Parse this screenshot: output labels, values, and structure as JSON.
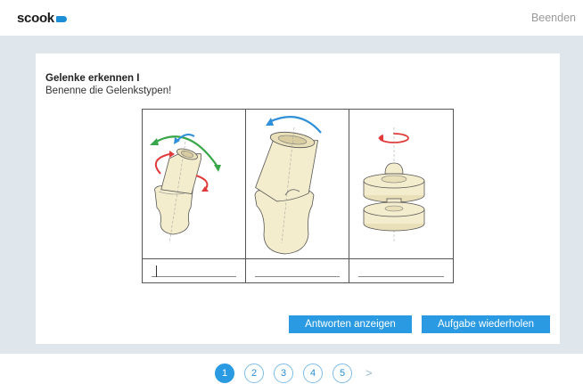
{
  "header": {
    "logo_text": "scook",
    "end_label": "Beenden"
  },
  "task": {
    "title": "Gelenke erkennen I",
    "instruction": "Benenne die Gelenkstypen!",
    "panels": [
      {
        "name": "ball-joint",
        "answer": ""
      },
      {
        "name": "hinge-joint",
        "answer": ""
      },
      {
        "name": "pivot-joint",
        "answer": ""
      }
    ]
  },
  "buttons": {
    "show_answers": "Antworten anzeigen",
    "repeat_task": "Aufgabe wiederholen"
  },
  "pager": {
    "pages": [
      "1",
      "2",
      "3",
      "4",
      "5"
    ],
    "current": "1",
    "next_symbol": ">"
  },
  "colors": {
    "accent": "#2a9ae2",
    "stage_bg": "#dfe6ec",
    "bone": "#f3eccd",
    "arrow_red": "#e03a3a",
    "arrow_green": "#3aa64a",
    "arrow_blue": "#2f8fd8"
  }
}
